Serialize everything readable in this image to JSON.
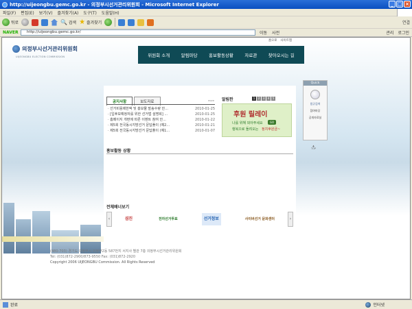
{
  "window": {
    "title": "http://uijeongbu.gemc.go.kr - 의정부시선거관리위원회 - Microsoft Internet Explorer",
    "minimize": "_",
    "maximize": "□",
    "close": "×"
  },
  "menubar": {
    "items": [
      "파일(F)",
      "편집(E)",
      "보기(V)",
      "즐겨찾기(A)",
      "도구(T)",
      "도움말(H)"
    ]
  },
  "toolbar": {
    "back": "뒤로",
    "search": "검색",
    "favorites": "즐겨찾기",
    "connect": "연결"
  },
  "addressbar": {
    "naver": "NAVER",
    "url": "http://uijeongbu.gemc.go.kr/",
    "go": "이동",
    "dictionary": "사전",
    "settings": "관리",
    "login": "로그인"
  },
  "site": {
    "logo_text": "의정부시선거관리위원회",
    "logo_sub": "UIJEONGBU ELECTION COMMISSION",
    "toplinks": [
      "홈으로",
      "사이트맵"
    ],
    "nav": [
      "위원회 소개",
      "알림마당",
      "홍보활동상황",
      "자료관",
      "찾아오시는 길"
    ],
    "tabs": [
      "공지사항",
      "보도자료"
    ],
    "more": "more",
    "notices": [
      {
        "title": "· 선거비용제한액 및 홍보물 발송수량 안...",
        "date": "2010-01-25"
      },
      {
        "title": "· [입후보예정자를 위한 선거법 설명회] ...",
        "date": "2010-01-25"
      },
      {
        "title": "· 홈페이지 개편에 따른 이벤트 참여 안...",
        "date": "2010-01-22"
      },
      {
        "title": "· 제5회 전국동시지방선거 문답풀이 (예2...",
        "date": "2010-01-21"
      },
      {
        "title": "· 제5회 전국동시지방선거 문답풀이 (예1...",
        "date": "2010-01-07"
      }
    ],
    "bulletin_title": "알림판",
    "bulletin_pages": [
      "1",
      "2",
      "3",
      "4",
      "5"
    ],
    "banner_title": "후원 릴레이",
    "banner_line1": "나를 위해 외아주세요",
    "banner_line2": "행복으로 돌려오는",
    "banner_line3": "정치후원금~",
    "banner_go": "GO",
    "promo_title": "홍보활동 상황",
    "banner_section_title": "전체배너보기",
    "banners": [
      "섬진",
      "전자선거투표",
      "선거정보",
      "사이버선거 문화센터"
    ],
    "quick_header": "Quick",
    "quick_items": [
      "법규검색",
      "참여마당",
      "공개자료실"
    ],
    "top": "TOP",
    "footer_line1": "(480-703) 경기도 의정부시 의정부2동 587번지 서지사 별관 7층 의정부시선거관리위원회",
    "footer_line2": "Tel: (031)872-2900/873-9550 Fax: (031)872-2920",
    "footer_copy": "Copyright 2006 UIJEONGBU Commission. All Rights Reserved"
  },
  "statusbar": {
    "text": "완료",
    "zone": "인터넷"
  }
}
